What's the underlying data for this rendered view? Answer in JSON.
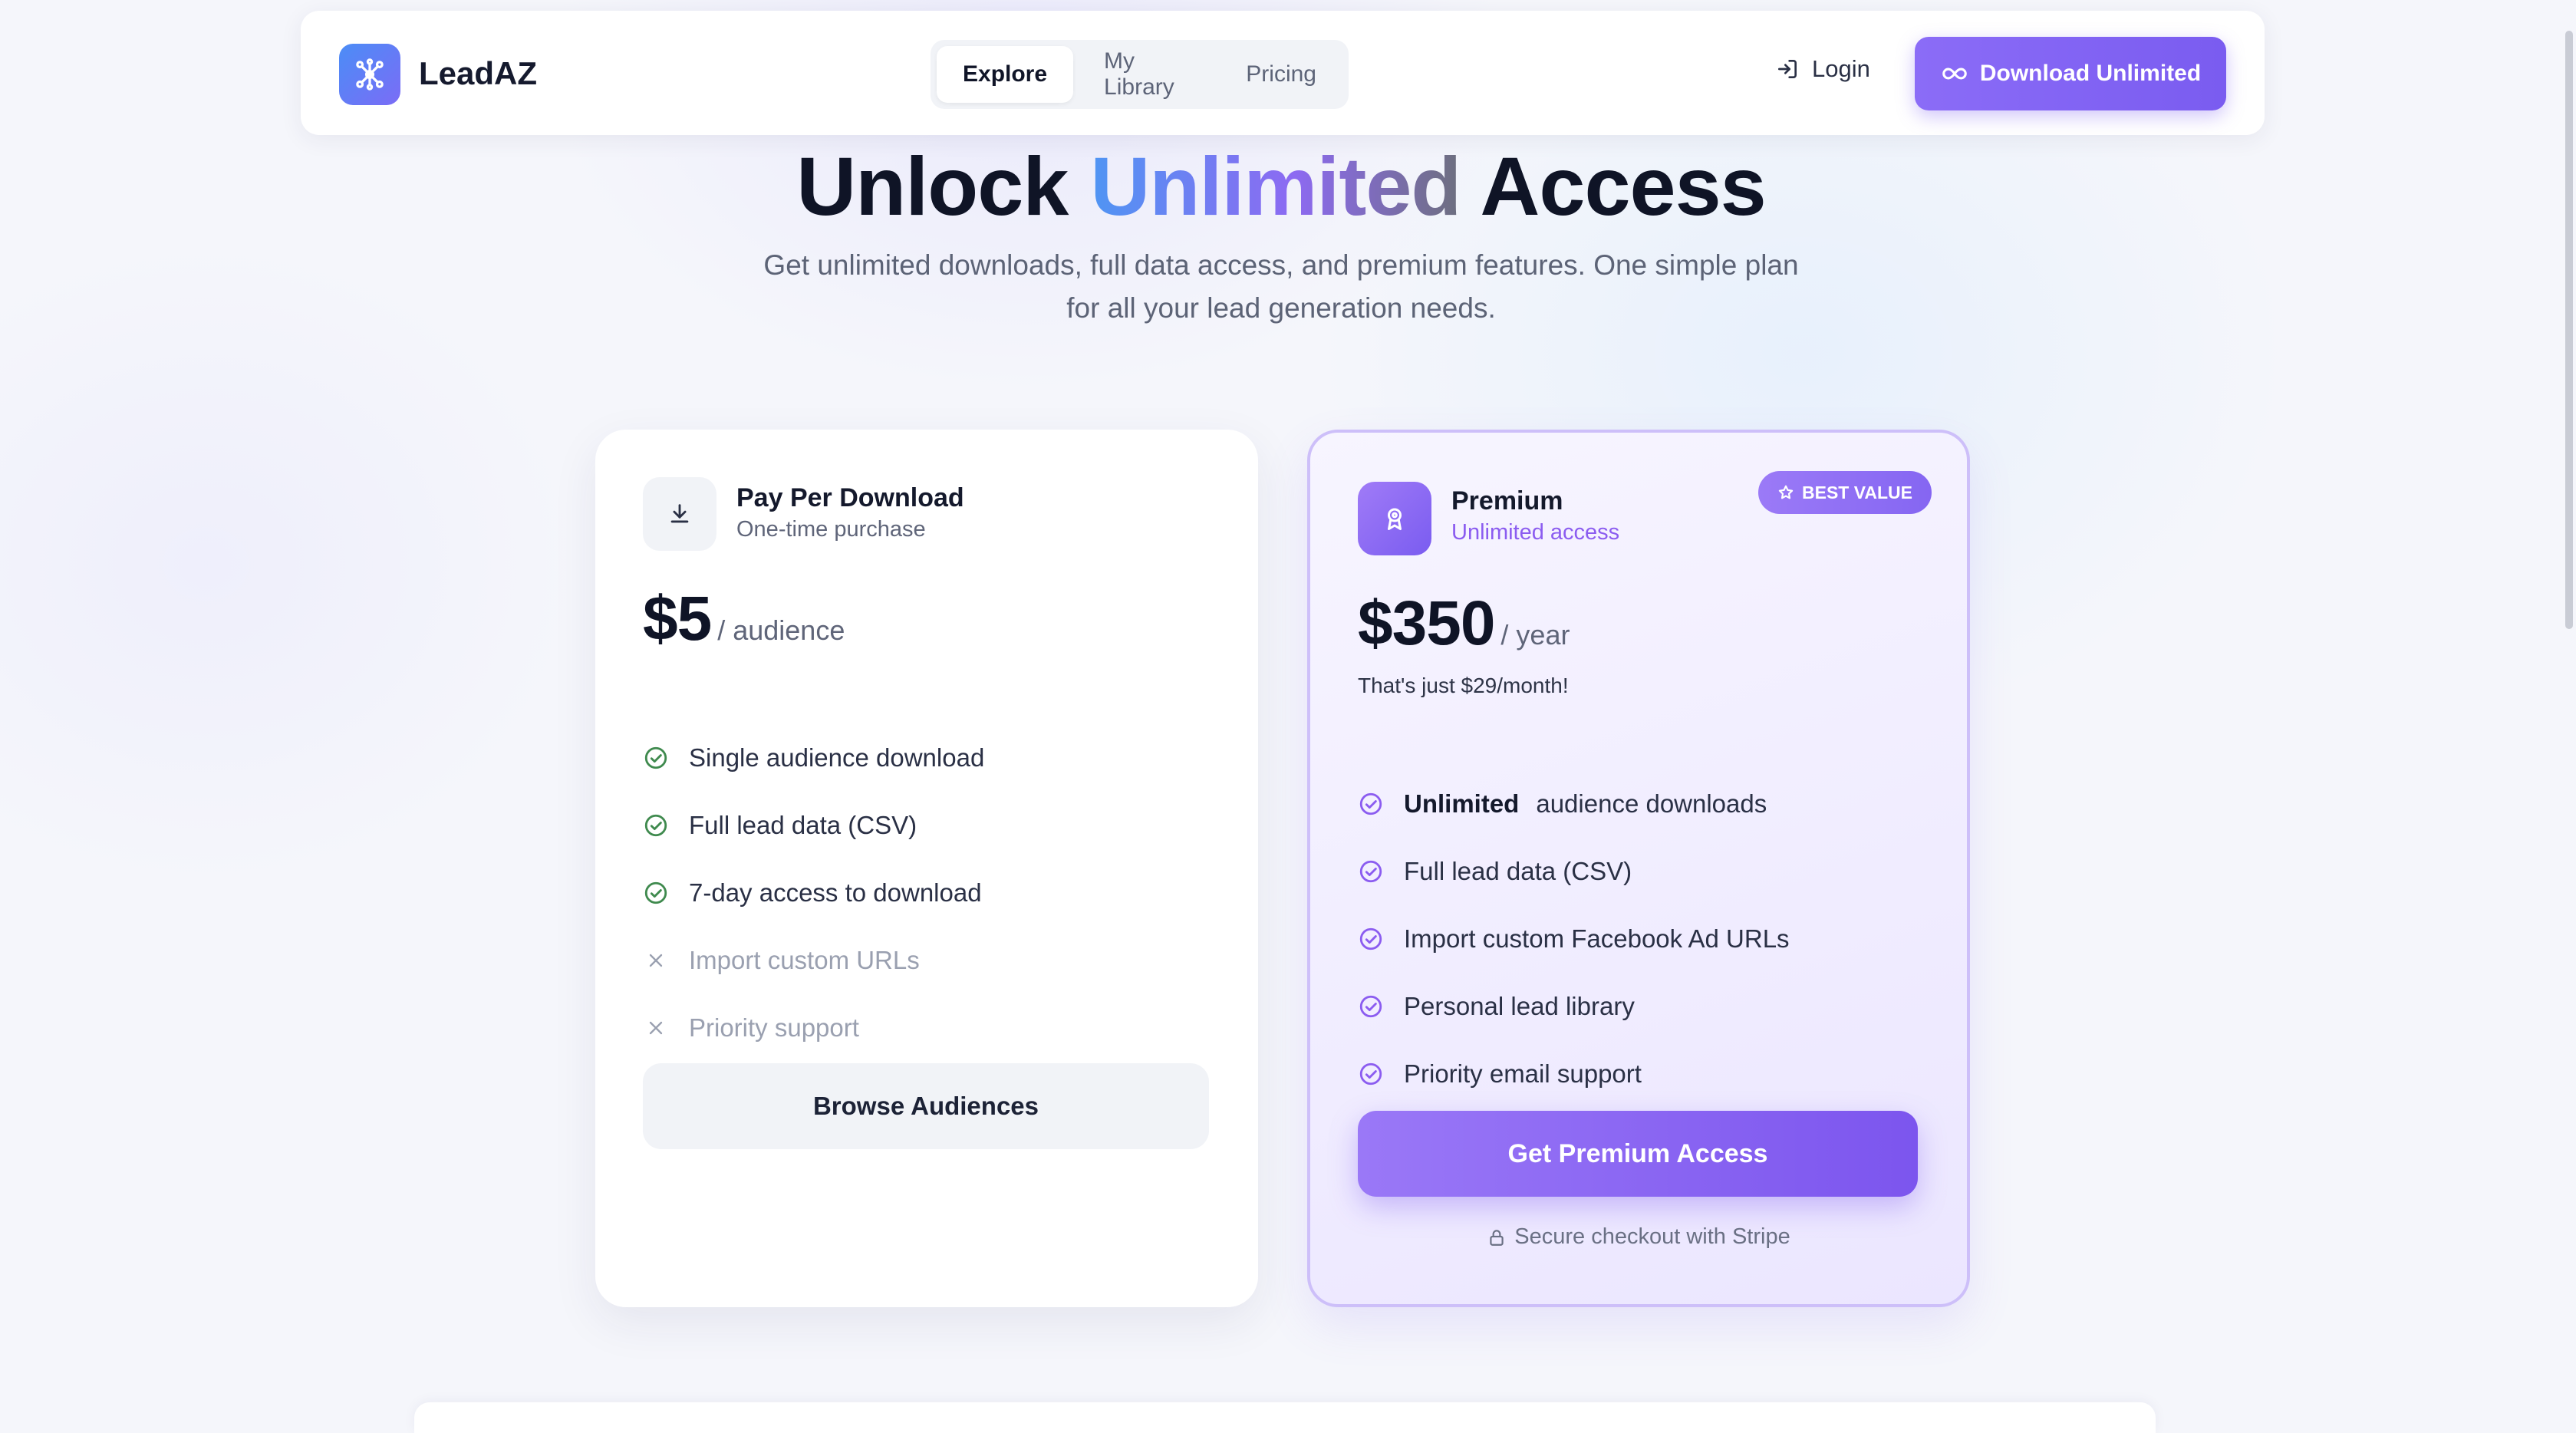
{
  "brand": {
    "name": "LeadAZ",
    "logo_icon": "network-icon"
  },
  "nav": {
    "tabs": [
      {
        "label": "Explore",
        "active": true
      },
      {
        "label": "My Library",
        "active": false
      },
      {
        "label": "Pricing",
        "active": false
      }
    ]
  },
  "header": {
    "login_label": "Login",
    "login_icon": "login-icon",
    "download_label": "Download Unlimited",
    "download_icon": "infinity-icon"
  },
  "hero": {
    "title_part1": "Unlock",
    "title_accent": "Unlimited",
    "title_part2": "Access",
    "subtitle": "Get unlimited downloads, full data access, and premium features. One simple plan for all your lead generation needs."
  },
  "plans": {
    "basic": {
      "icon": "download-icon",
      "name": "Pay Per Download",
      "desc": "One-time purchase",
      "price": "$5",
      "unit": "/ audience",
      "features": [
        {
          "text": "Single audience download",
          "included": true
        },
        {
          "text": "Full lead data (CSV)",
          "included": true
        },
        {
          "text": "7-day access to download",
          "included": true
        },
        {
          "text": "Import custom URLs",
          "included": false
        },
        {
          "text": "Priority support",
          "included": false
        }
      ],
      "cta": "Browse Audiences"
    },
    "premium": {
      "icon": "award-icon",
      "name": "Premium",
      "desc": "Unlimited access",
      "badge": "BEST VALUE",
      "price": "$350",
      "unit": "/ year",
      "note": "That's just $29/month!",
      "features": [
        {
          "strong": "Unlimited",
          "text": "audience downloads"
        },
        {
          "text": "Full lead data (CSV)"
        },
        {
          "text": "Import custom Facebook Ad URLs"
        },
        {
          "text": "Personal lead library"
        },
        {
          "text": "Priority email support"
        }
      ],
      "cta": "Get Premium Access",
      "secure_note": "Secure checkout with Stripe"
    }
  },
  "colors": {
    "accent": "#7c5cf0",
    "check_green": "#3f8a4e",
    "check_purple": "#8b5cf0",
    "muted": "#9aa0b0"
  }
}
